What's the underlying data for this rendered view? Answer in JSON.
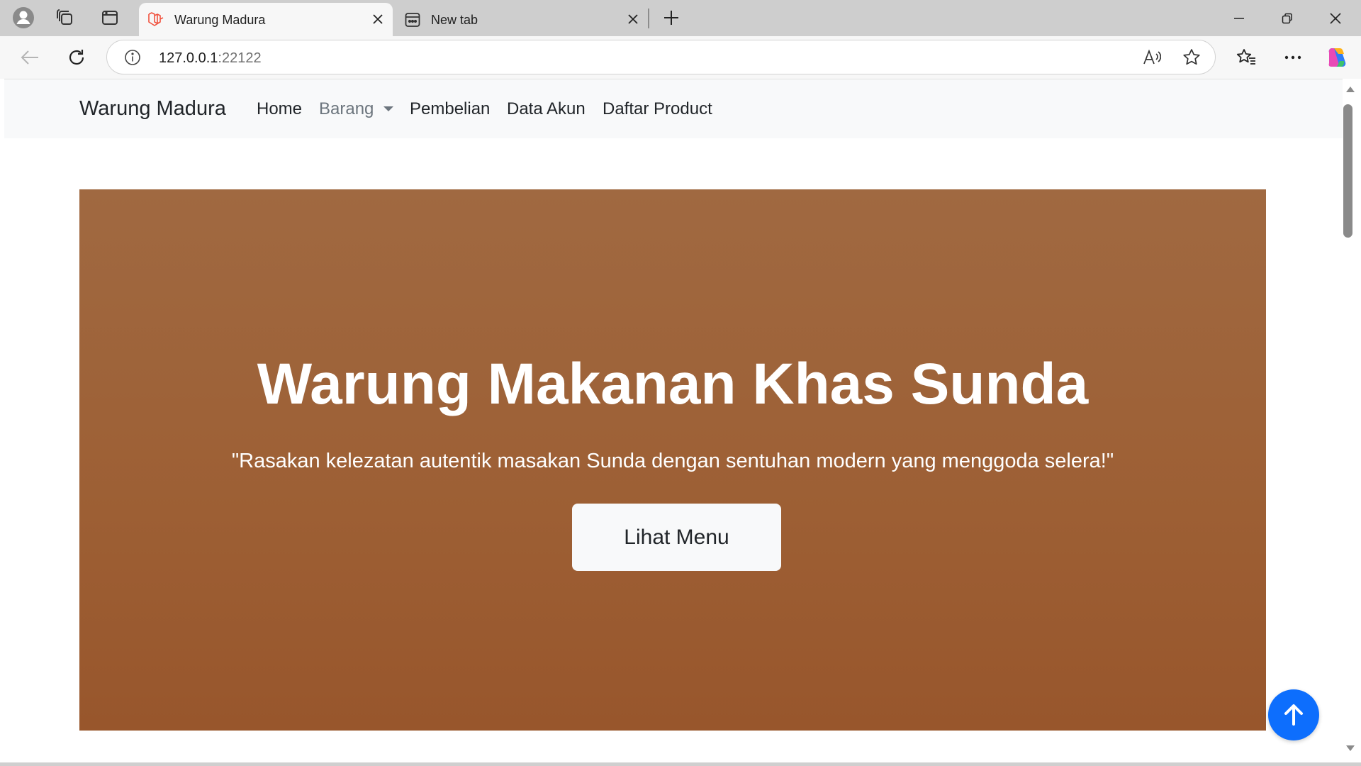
{
  "browser": {
    "tabs": [
      {
        "title": "Warung Madura",
        "icon": "laravel-icon",
        "active": true
      },
      {
        "title": "New tab",
        "icon": "new-tab-page-icon",
        "active": false
      }
    ],
    "address": {
      "host": "127.0.0.1",
      "port": ":22122"
    },
    "icons": {
      "profile": "profile-icon",
      "workspaces": "workspaces-icon",
      "tab_actions": "tab-actions-icon",
      "back": "back-arrow-icon",
      "reload": "reload-icon",
      "info": "info-icon",
      "read_aloud": "read-aloud-icon",
      "favorite": "favorite-star-icon",
      "favorites": "favorites-icon",
      "more": "more-icon",
      "copilot": "copilot-icon"
    }
  },
  "page": {
    "navbar": {
      "brand": "Warung Madura",
      "links": {
        "home": "Home",
        "barang": "Barang",
        "pembelian": "Pembelian",
        "data_akun": "Data Akun",
        "daftar_product": "Daftar Product"
      }
    },
    "hero": {
      "title": "Warung Makanan Khas Sunda",
      "tagline": "\"Rasakan kelezatan autentik masakan Sunda dengan sentuhan modern yang menggoda selera!\"",
      "cta": "Lihat Menu",
      "background_color": "#9d5f34"
    },
    "back_to_top_color": "#0d6efd"
  }
}
